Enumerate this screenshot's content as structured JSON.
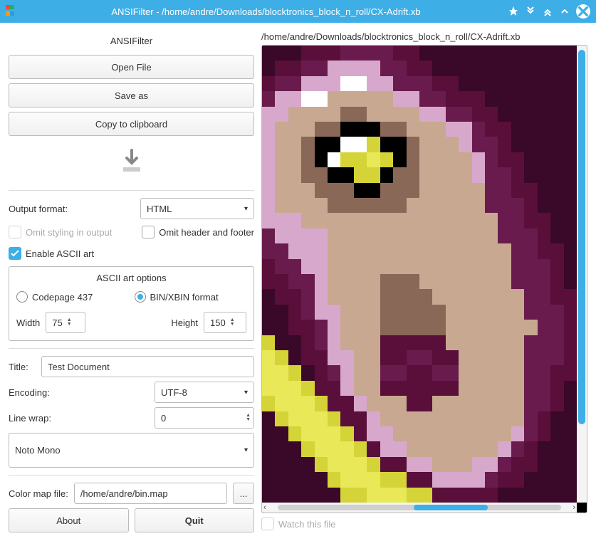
{
  "window": {
    "title": "ANSIFilter - /home/andre/Downloads/blocktronics_block_n_roll/CX-Adrift.xb",
    "app_icon_colors": [
      "#e74c3c",
      "#27ae60",
      "#f39c12",
      "#3498db"
    ]
  },
  "panel": {
    "title": "ANSIFilter",
    "open_file": "Open File",
    "save_as": "Save as",
    "copy_clipboard": "Copy to clipboard"
  },
  "output": {
    "format_label": "Output format:",
    "format_value": "HTML",
    "omit_styling": "Omit styling in output",
    "omit_header": "Omit header and footer",
    "enable_ascii": "Enable ASCII art"
  },
  "ascii": {
    "title": "ASCII art options",
    "cp437": "Codepage 437",
    "bin": "BIN/XBIN format",
    "width_label": "Width",
    "width_value": "75",
    "height_label": "Height",
    "height_value": "150"
  },
  "fields": {
    "title_label": "Title:",
    "title_value": "Test Document",
    "encoding_label": "Encoding:",
    "encoding_value": "UTF-8",
    "linewrap_label": "Line wrap:",
    "linewrap_value": "0",
    "font_value": "Noto Mono",
    "colormap_label": "Color map file:",
    "colormap_value": "/home/andre/bin.map",
    "browse": "..."
  },
  "bottom": {
    "about": "About",
    "quit": "Quit"
  },
  "preview": {
    "path": "/home/andre/Downloads/blocktronics_block_n_roll/CX-Adrift.xb",
    "watch": "Watch this file"
  }
}
